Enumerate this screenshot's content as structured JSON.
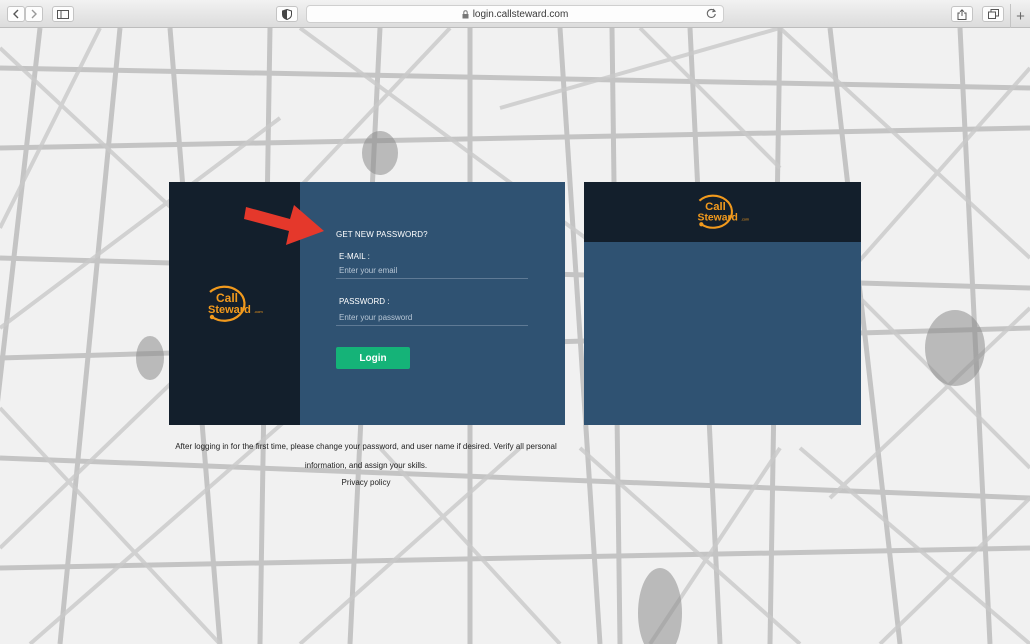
{
  "browser": {
    "url": "login.callsteward.com",
    "icons": {
      "back": "chevron-left-icon",
      "forward": "chevron-right-icon",
      "sidebar": "sidebar-icon",
      "privacy": "shield-icon",
      "lock": "lock-icon",
      "reload": "reload-icon",
      "share": "share-icon",
      "tabs": "tabs-icon",
      "new_tab": "plus-icon"
    },
    "new_tab_label": "+"
  },
  "logo": {
    "line1": "Call",
    "line2": "Steward",
    "suffix": ".com",
    "color": "#f29a1d"
  },
  "login": {
    "forgot_link": "GET NEW PASSWORD?",
    "email_label": "E-MAIL :",
    "email_placeholder": "Enter your email",
    "email_value": "",
    "password_label": "PASSWORD :",
    "password_placeholder": "Enter your password",
    "password_value": "",
    "login_button": "Login"
  },
  "footer": {
    "notice": "After logging in for the first time, please change your password, and user name if desired. Verify all personal information, and assign your skills.",
    "privacy_link": "Privacy policy"
  },
  "colors": {
    "dark_panel": "#131f2c",
    "blue_panel": "#2f5272",
    "login_button": "#15b378",
    "annotation_arrow": "#e5382b"
  }
}
